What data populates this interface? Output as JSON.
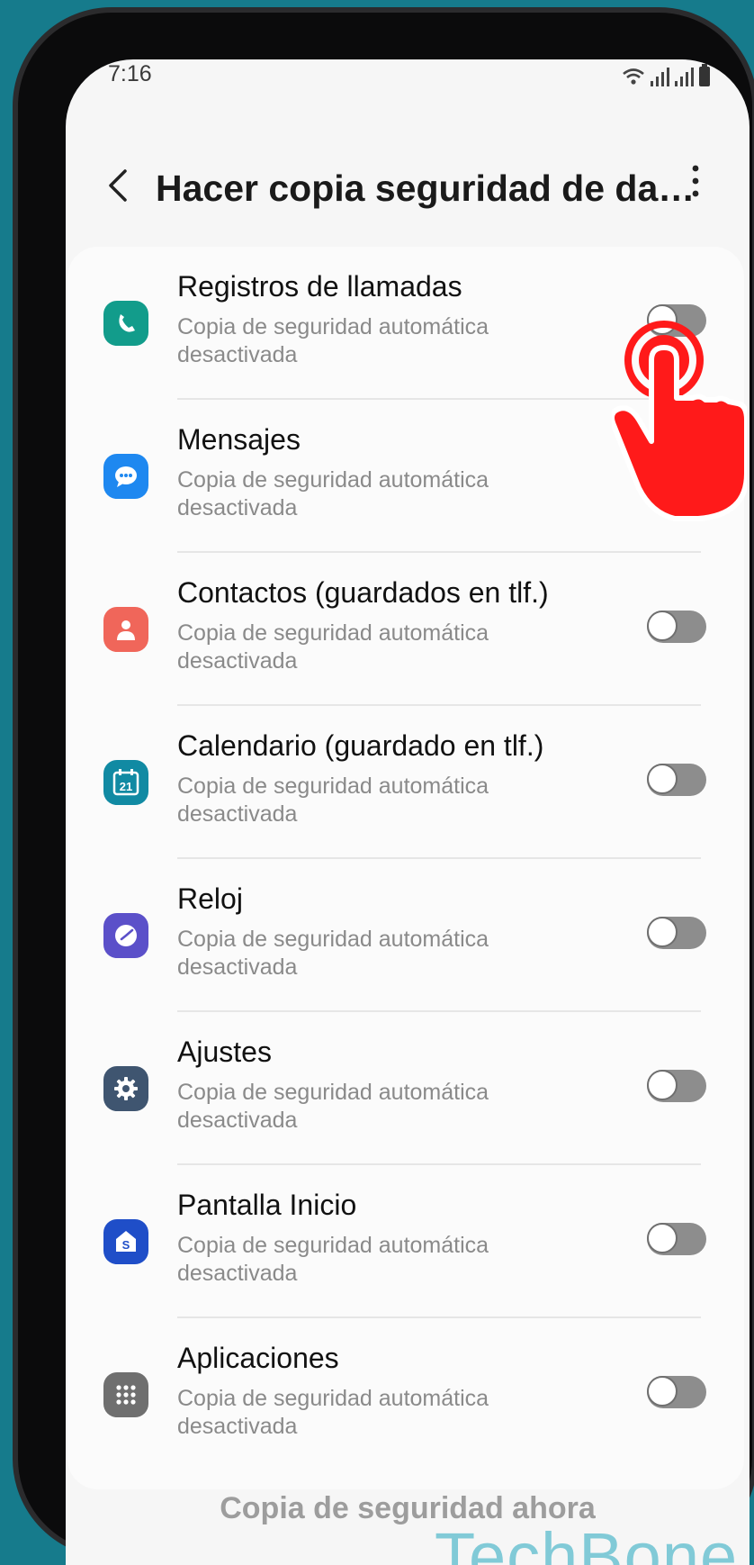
{
  "status_bar": {
    "time": "7:16"
  },
  "header": {
    "title": "Hacer copia seguridad de da…"
  },
  "items": [
    {
      "label": "Registros de llamadas",
      "subtitle": "Copia de seguridad automática desactivada",
      "icon": "phone-icon",
      "icon_color": "#129c8b",
      "enabled": false
    },
    {
      "label": "Mensajes",
      "subtitle": "Copia de seguridad automática desactivada",
      "icon": "message-icon",
      "icon_color": "#1e88f0",
      "enabled": false
    },
    {
      "label": "Contactos (guardados en tlf.)",
      "subtitle": "Copia de seguridad automática desactivada",
      "icon": "contact-icon",
      "icon_color": "#f0665a",
      "enabled": false
    },
    {
      "label": "Calendario (guardado en tlf.)",
      "subtitle": "Copia de seguridad automática desactivada",
      "icon": "calendar-icon",
      "icon_text": "21",
      "icon_color": "#118aa3",
      "enabled": false
    },
    {
      "label": "Reloj",
      "subtitle": "Copia de seguridad automática desactivada",
      "icon": "clock-icon",
      "icon_color": "#5b50c9",
      "enabled": false
    },
    {
      "label": "Ajustes",
      "subtitle": "Copia de seguridad automática desactivada",
      "icon": "gear-icon",
      "icon_color": "#3f5570",
      "enabled": false
    },
    {
      "label": "Pantalla Inicio",
      "subtitle": "Copia de seguridad automática desactivada",
      "icon": "home-screen-icon",
      "icon_text": "S",
      "icon_color": "#1f4ec8",
      "enabled": false
    },
    {
      "label": "Aplicaciones",
      "subtitle": "Copia de seguridad automática desactivada",
      "icon": "apps-icon",
      "icon_color": "#6f6f6f",
      "enabled": false
    }
  ],
  "footer": {
    "backup_now_label": "Copia de seguridad ahora"
  },
  "watermark": "TechBone"
}
